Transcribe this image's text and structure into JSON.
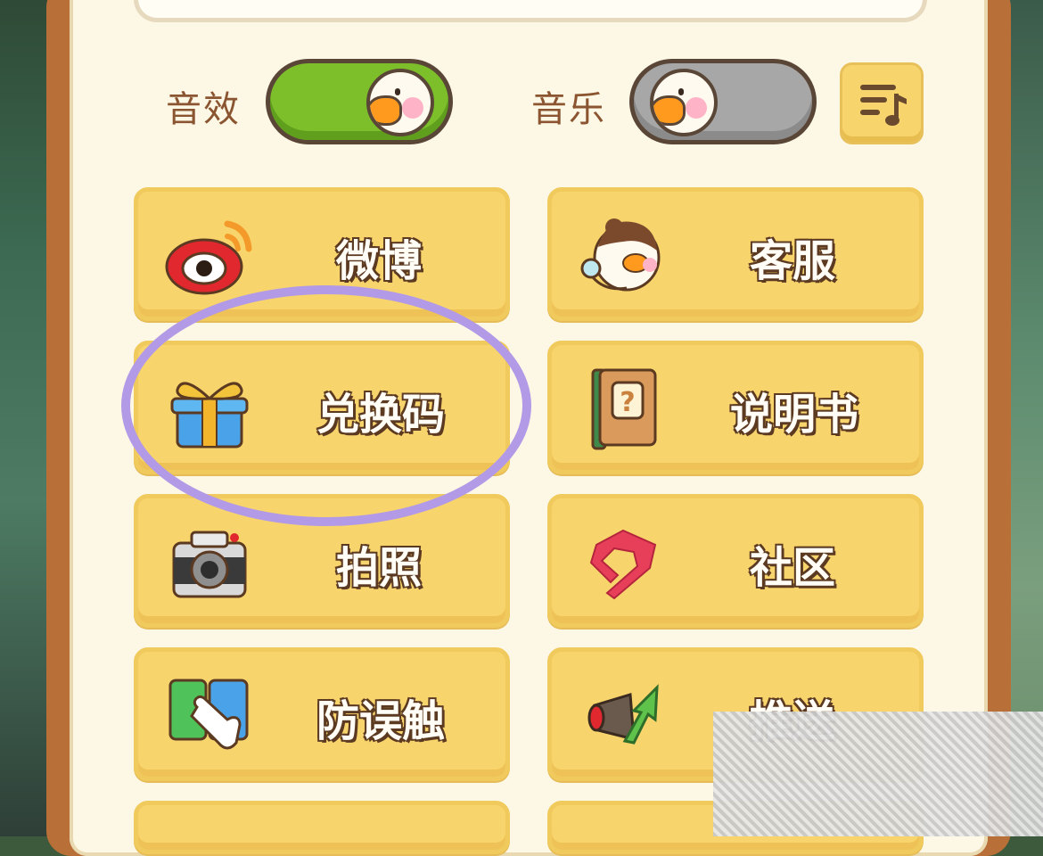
{
  "settings": {
    "sound_label": "音效",
    "music_label": "音乐",
    "sound_on": true,
    "music_on": false
  },
  "menu": {
    "weibo": "微博",
    "support": "客服",
    "redeem": "兑换码",
    "manual": "说明书",
    "photo": "拍照",
    "community": "社区",
    "anti_touch": "防误触",
    "push": "推送"
  },
  "colors": {
    "card": "#f8d56c",
    "toggle_on": "#7dbf2b",
    "toggle_off": "#a7a7a7",
    "highlight_ring": "#b39ae6"
  }
}
